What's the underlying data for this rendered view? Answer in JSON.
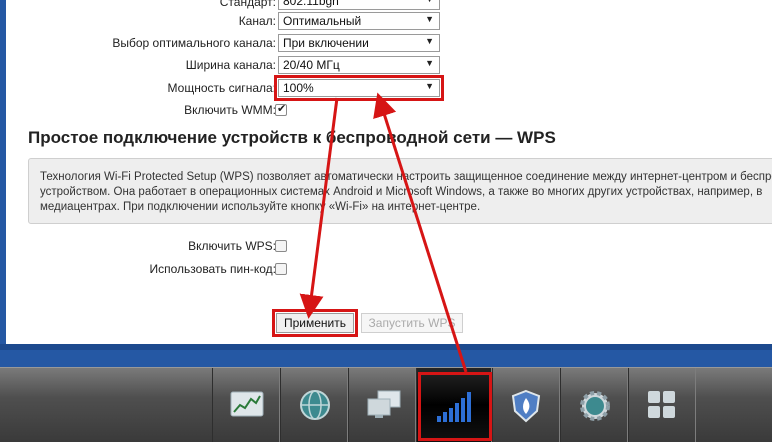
{
  "wifi_settings": {
    "standard": {
      "label": "Стандарт:",
      "value": "802.11bgn"
    },
    "channel": {
      "label": "Канал:",
      "value": "Оптимальный"
    },
    "optimal_channel": {
      "label": "Выбор оптимального канала:",
      "value": "При включении"
    },
    "channel_width": {
      "label": "Ширина канала:",
      "value": "20/40 МГц"
    },
    "signal_power": {
      "label": "Мощность сигнала:",
      "value": "100%"
    },
    "wmm": {
      "label": "Включить WMM:",
      "checked": true
    }
  },
  "wps": {
    "title": "Простое подключение устройств к беспроводной сети — WPS",
    "info_lines": [
      "Технология Wi-Fi Protected Setup (WPS) позволяет автоматически настроить защищенное соединение между интернет-центром и беспроводным",
      "устройством. Она работает в операционных системах Android и Microsoft Windows, а также во многих других устройствах, например, в",
      "медиацентрах. При подключении используйте кнопку «Wi-Fi» на интернет-центре."
    ],
    "enable_wps": {
      "label": "Включить WPS:",
      "checked": false
    },
    "use_pin": {
      "label": "Использовать пин-код:",
      "checked": false
    }
  },
  "buttons": {
    "apply": "Применить",
    "start_wps": "Запустить WPS"
  },
  "taskbar": {
    "items": [
      {
        "icon": "monitoring-chart-icon"
      },
      {
        "icon": "internet-globe-icon"
      },
      {
        "icon": "home-network-icon"
      },
      {
        "icon": "wifi-signal-icon",
        "active": true
      },
      {
        "icon": "security-shield-icon"
      },
      {
        "icon": "settings-gear-icon"
      },
      {
        "icon": "apps-grid-icon"
      }
    ]
  },
  "colors": {
    "highlight": "#d61515",
    "background": "#2558a4"
  }
}
